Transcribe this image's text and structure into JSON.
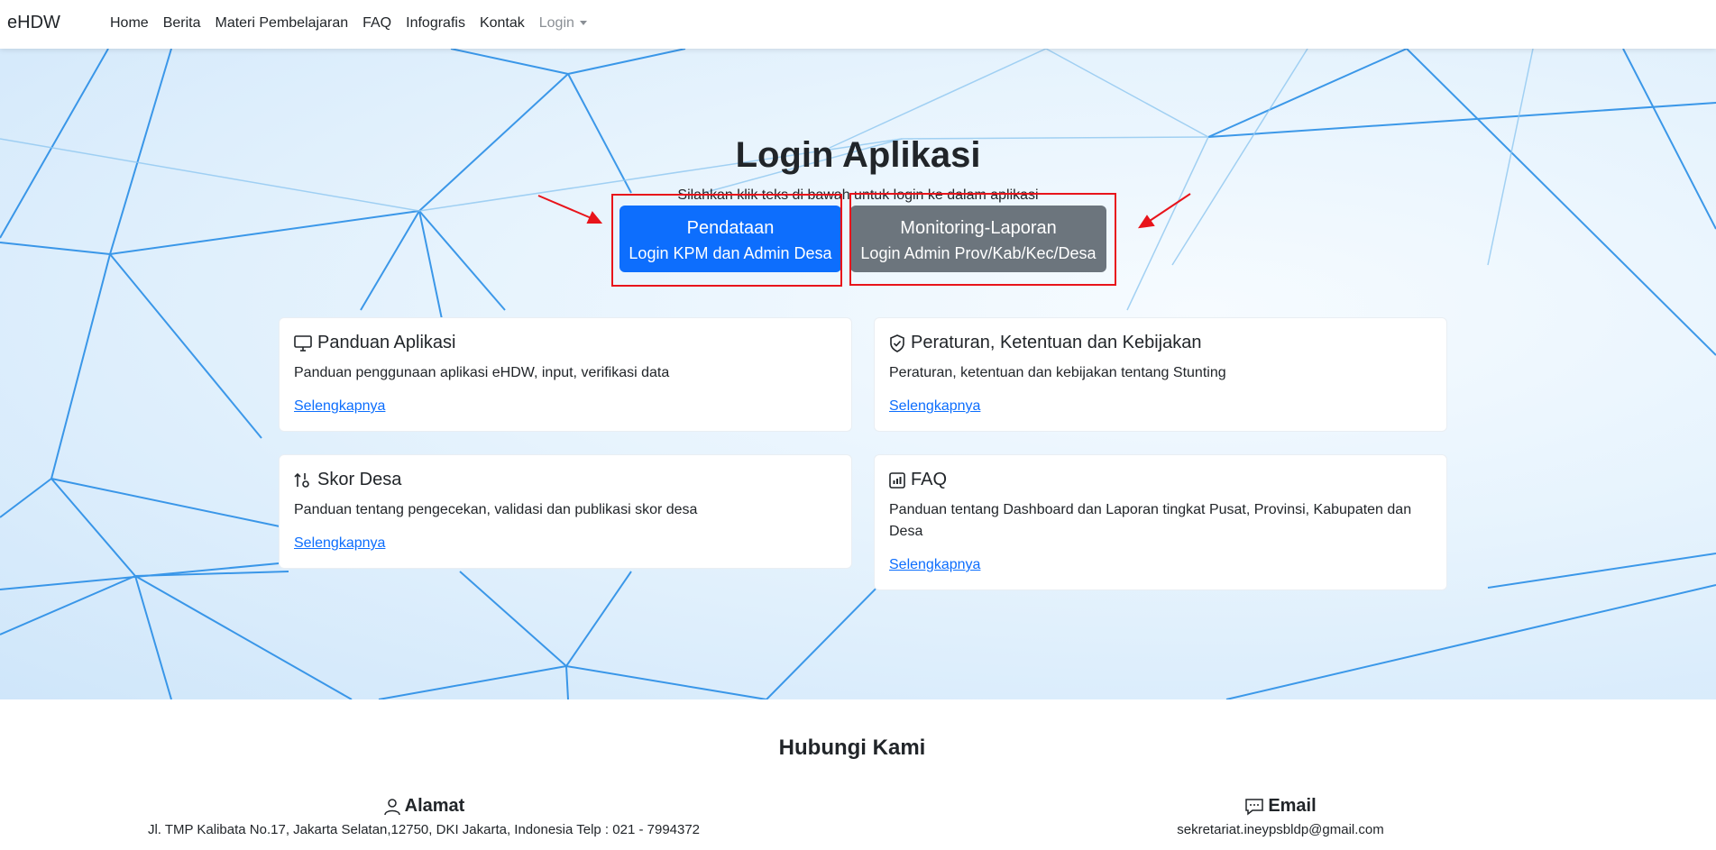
{
  "navbar": {
    "brand": "eHDW",
    "items": [
      "Home",
      "Berita",
      "Materi Pembelajaran",
      "FAQ",
      "Infografis",
      "Kontak"
    ],
    "login_label": "Login"
  },
  "hero": {
    "title": "Login Aplikasi",
    "subtitle": "Silahkan klik teks di bawah untuk login ke dalam aplikasi",
    "buttons": [
      {
        "line1": "Pendataan",
        "line2": "Login KPM dan Admin Desa",
        "color": "#0d6efd"
      },
      {
        "line1": "Monitoring-Laporan",
        "line2": "Login Admin Prov/Kab/Kec/Desa",
        "color": "#6c757d"
      }
    ],
    "highlight_color": "#e8141b"
  },
  "cards": [
    {
      "icon": "monitor-icon",
      "title": "Panduan Aplikasi",
      "text": "Panduan penggunaan aplikasi eHDW, input, verifikasi data",
      "link": "Selengkapnya"
    },
    {
      "icon": "shield-check-icon",
      "title": "Peraturan, Ketentuan dan Kebijakan",
      "text": "Peraturan, ketentuan dan kebijakan tentang Stunting",
      "link": "Selengkapnya"
    },
    {
      "icon": "sort-numeric-icon",
      "title": "Skor Desa",
      "text": "Panduan tentang pengecekan, validasi dan publikasi skor desa",
      "link": "Selengkapnya"
    },
    {
      "icon": "bar-chart-icon",
      "title": "FAQ",
      "text": "Panduan tentang Dashboard dan Laporan tingkat Pusat, Provinsi, Kabupaten dan Desa",
      "link": "Selengkapnya"
    }
  ],
  "contact": {
    "title": "Hubungi Kami",
    "address": {
      "icon": "person-icon",
      "label": "Alamat",
      "text": "Jl. TMP Kalibata No.17, Jakarta Selatan,12750, DKI Jakarta, Indonesia Telp : 021 - 7994372"
    },
    "email": {
      "icon": "chat-icon",
      "label": "Email",
      "text": "sekretariat.ineypsbldp@gmail.com"
    }
  },
  "colors": {
    "primary": "#0d6efd",
    "secondary": "#6c757d",
    "link": "#0d6efd"
  }
}
